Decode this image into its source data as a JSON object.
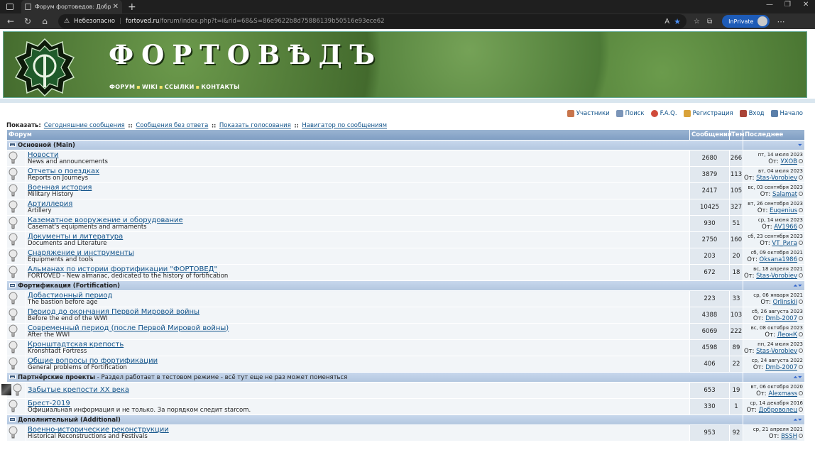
{
  "browser": {
    "tab_title": "Форум фортоведов: Добро пож...",
    "warning_label": "Небезопасно",
    "url_host": "fortoved.ru",
    "url_path": "/forum/index.php?t=i&rid=68&S=86e9622b8d75886139b50516e93ece62",
    "inprivate_label": "InPrivate",
    "reader_icon": "A"
  },
  "site": {
    "name": "ФОРТОВѢДЪ",
    "nav": [
      "ФОРУМ",
      "WIKI",
      "ССЫЛКИ",
      "КОНТАКТЫ"
    ]
  },
  "toplinks": [
    "Участники",
    "Поиск",
    "F.A.Q.",
    "Регистрация",
    "Вход",
    "Начало"
  ],
  "show_label": "Показать:",
  "show_links": [
    "Сегодняшние сообщения",
    "Сообщения без ответа",
    "Показать голосования",
    "Навигатор по сообщениям"
  ],
  "table_headers": {
    "forum": "Форум",
    "posts": "Сообщений",
    "topics": "Тем",
    "last": "Последнее"
  },
  "from_label": "От:",
  "categories": [
    {
      "name": "Основной (Main)",
      "note": "",
      "forums": [
        {
          "title": "Новости",
          "desc": "News and announcements",
          "posts": "2680",
          "topics": "266",
          "date": "пт, 14 июля 2023",
          "user": "УХОВ"
        },
        {
          "title": "Отчеты о поездках",
          "desc": "Reports on Journeys",
          "posts": "3879",
          "topics": "113",
          "date": "вт, 04 июля 2023",
          "user": "Stas-Vorobiev"
        },
        {
          "title": "Военная история",
          "desc": "Military History",
          "posts": "2417",
          "topics": "105",
          "date": "вс, 03 сентября 2023",
          "user": "Salamat"
        },
        {
          "title": "Артиллерия",
          "desc": "Artillery",
          "posts": "10425",
          "topics": "327",
          "date": "вт, 26 сентября 2023",
          "user": "Eugenius"
        },
        {
          "title": "Казематное вооружение и оборудование",
          "desc": "Casemat's equipments and armaments",
          "posts": "930",
          "topics": "51",
          "date": "ср, 14 июня 2023",
          "user": "AV1966"
        },
        {
          "title": "Документы и литература",
          "desc": "Documents and Literature",
          "posts": "2750",
          "topics": "160",
          "date": "сб, 23 сентября 2023",
          "user": "VT_Рига"
        },
        {
          "title": "Снаряжение и инструменты",
          "desc": "Equipments and tools",
          "posts": "203",
          "topics": "20",
          "date": "сб, 09 октября 2021",
          "user": "Oksana1986"
        },
        {
          "title": "Альманах по истории фортификации \"ФОРТОВЕД\"",
          "desc": "FORTOVED - New almanac, dedicated to the history of fortification",
          "posts": "672",
          "topics": "18",
          "date": "вс, 18 апреля 2021",
          "user": "Stas-Vorobiev"
        }
      ]
    },
    {
      "name": "Фортификация (Fortification)",
      "note": "",
      "forums": [
        {
          "title": "Добастионный период",
          "desc": "The bastion before age",
          "posts": "223",
          "topics": "33",
          "date": "ср, 06 января 2021",
          "user": "Orlinskii"
        },
        {
          "title": "Период до окончания Первой Мировой войны",
          "desc": "Before the end of the WWI",
          "posts": "4388",
          "topics": "103",
          "date": "сб, 26 августа 2023",
          "user": "Dmb-2007"
        },
        {
          "title": "Современный период (после Первой Мировой войны)",
          "desc": "After the WWI",
          "posts": "6069",
          "topics": "222",
          "date": "вс, 08 октября 2023",
          "user": "ЛеонК"
        },
        {
          "title": "Кронштадтская крепость",
          "desc": "Kronshtadt Fortress",
          "posts": "4598",
          "topics": "89",
          "date": "пн, 24 июля 2023",
          "user": "Stas-Vorobiev"
        },
        {
          "title": "Общие вопросы по фортификации",
          "desc": "General problems of Fortification",
          "posts": "406",
          "topics": "22",
          "date": "ср, 24 августа 2022",
          "user": "Dmb-2007"
        }
      ]
    },
    {
      "name": "Партнёрские проекты",
      "note": " - Раздел работает в тестовом режиме - всё тут еще не раз может поменяться",
      "forums": [
        {
          "title": "Забытые крепости XX века",
          "desc": "",
          "posts": "653",
          "topics": "19",
          "date": "вт, 06 октября 2020",
          "user": "Alexmass"
        },
        {
          "title": "Брест-2019",
          "desc": "Официальная информация и не только. За порядком следит starcom.",
          "posts": "330",
          "topics": "1",
          "date": "ср, 14 декабря 2016",
          "user": "Доброволец"
        }
      ]
    },
    {
      "name": "Дополнительный (Additional)",
      "note": "",
      "forums": [
        {
          "title": "Военно-исторические реконструкции",
          "desc": "Historical Reconstructions and Festivals",
          "posts": "953",
          "topics": "92",
          "date": "ср, 21 апреля 2021",
          "user": "BSSH"
        }
      ]
    }
  ]
}
